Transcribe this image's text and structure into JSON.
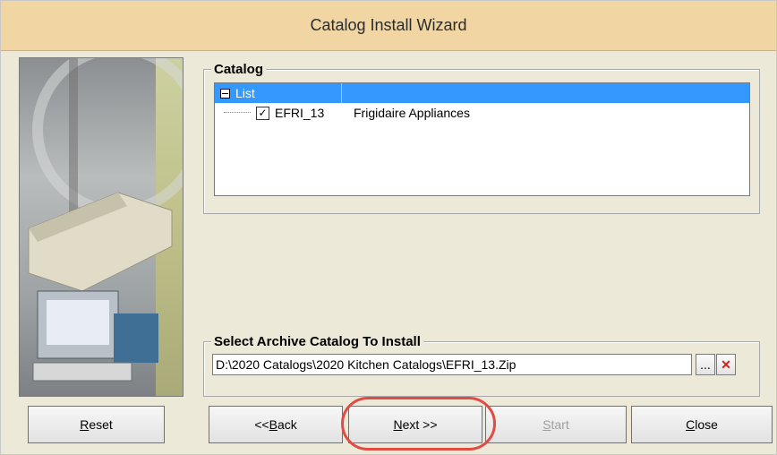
{
  "window": {
    "title": "Catalog Install Wizard"
  },
  "catalog": {
    "group_title": "Catalog",
    "tree": {
      "root_label": "List",
      "items": [
        {
          "code": "EFRI_13",
          "name": "Frigidaire Appliances",
          "checked": true
        }
      ]
    }
  },
  "archive": {
    "group_title": "Select Archive Catalog To Install",
    "path_value": "D:\\2020 Catalogs\\2020 Kitchen Catalogs\\EFRI_13.Zip",
    "browse_label": "...",
    "clear_label": "✕"
  },
  "buttons": {
    "reset_first": "R",
    "reset_rest": "eset",
    "back_prefix": "<< ",
    "back_underline": "B",
    "back_rest": "ack",
    "next_underline": "N",
    "next_rest": "ext >>",
    "start_first": "S",
    "start_rest": "tart",
    "close_first": "C",
    "close_rest": "lose"
  },
  "colors": {
    "title_bg": "#f1d6a3",
    "selected_row": "#3399ff",
    "highlight": "#e04b44",
    "clear_icon": "#d21f1f"
  }
}
